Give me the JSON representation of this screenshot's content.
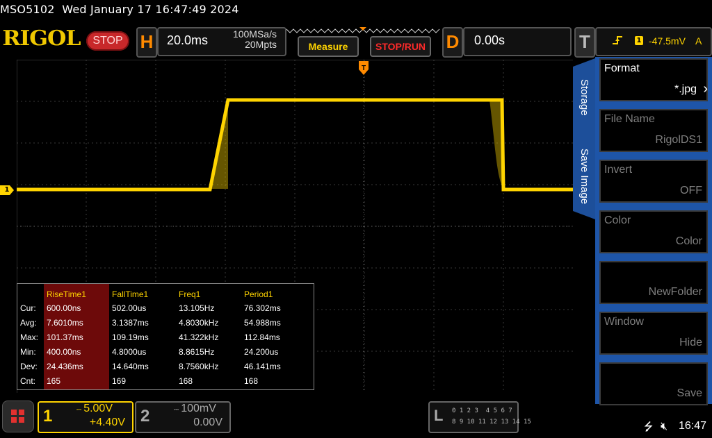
{
  "header": {
    "model": "MSO5102",
    "datetime": "Wed January 17 16:47:49 2024",
    "logo": "RIGOL",
    "run_state": "STOP"
  },
  "horizontal": {
    "letter": "H",
    "timebase": "20.0ms",
    "sample_rate": "100MSa/s",
    "memory_depth": "20Mpts"
  },
  "buttons": {
    "measure": "Measure",
    "stop_run": "STOP/RUN"
  },
  "delay": {
    "letter": "D",
    "value": "0.00s"
  },
  "trigger": {
    "letter": "T",
    "channel": "1",
    "level": "-47.5mV",
    "mode": "A",
    "slope_icon": "rising-edge-icon"
  },
  "channels": {
    "ch1": {
      "number": "1",
      "scale": "5.00V",
      "offset": "+4.40V",
      "marker": "1",
      "color": "#ffd400"
    },
    "ch2": {
      "number": "2",
      "scale": "100mV",
      "offset": "0.00V"
    }
  },
  "measurements": {
    "row_labels": [
      "Cur:",
      "Avg:",
      "Max:",
      "Min:",
      "Dev:",
      "Cnt:"
    ],
    "columns": [
      {
        "name": "RiseTime1",
        "values": [
          "600.00ns",
          "7.6010ms",
          "101.37ms",
          "400.00ns",
          "24.436ms",
          "165"
        ]
      },
      {
        "name": "FallTime1",
        "values": [
          "502.00us",
          "3.1387ms",
          "109.19ms",
          "4.8000us",
          "14.640ms",
          "169"
        ]
      },
      {
        "name": "Freq1",
        "values": [
          "13.105Hz",
          "4.8030kHz",
          "41.322kHz",
          "8.8615Hz",
          "8.7560kHz",
          "168"
        ]
      },
      {
        "name": "Period1",
        "values": [
          "76.302ms",
          "54.988ms",
          "112.84ms",
          "24.200us",
          "46.141ms",
          "168"
        ]
      }
    ]
  },
  "menu": {
    "tabs": [
      "Storage",
      "Save Image"
    ],
    "items": [
      {
        "title": "Format",
        "value": "*.jpg",
        "state": "active"
      },
      {
        "title": "File Name",
        "value": "RigolDS1",
        "state": "dim"
      },
      {
        "title": "Invert",
        "value": "OFF",
        "state": "dim"
      },
      {
        "title": "Color",
        "value": "Color",
        "state": "dim"
      },
      {
        "title": "",
        "value": "NewFolder",
        "state": "dim"
      },
      {
        "title": "Window",
        "value": "Hide",
        "state": "dim"
      },
      {
        "title": "",
        "value": "Save",
        "state": "dim"
      }
    ]
  },
  "logic_analyzer": {
    "letter": "L",
    "row1": "0 1 2 3  4 5 6 7",
    "row2": "8 9 10 11 12 13 14 15"
  },
  "status_bar": {
    "time": "16:47",
    "usb_icon": "usb-icon",
    "speaker_icon": "speaker-muted-icon"
  },
  "colors": {
    "trace": "#ffd400",
    "menu_blue": "#1e55a8",
    "stop_red": "#c8282a",
    "accent_orange": "#ff8a00"
  }
}
